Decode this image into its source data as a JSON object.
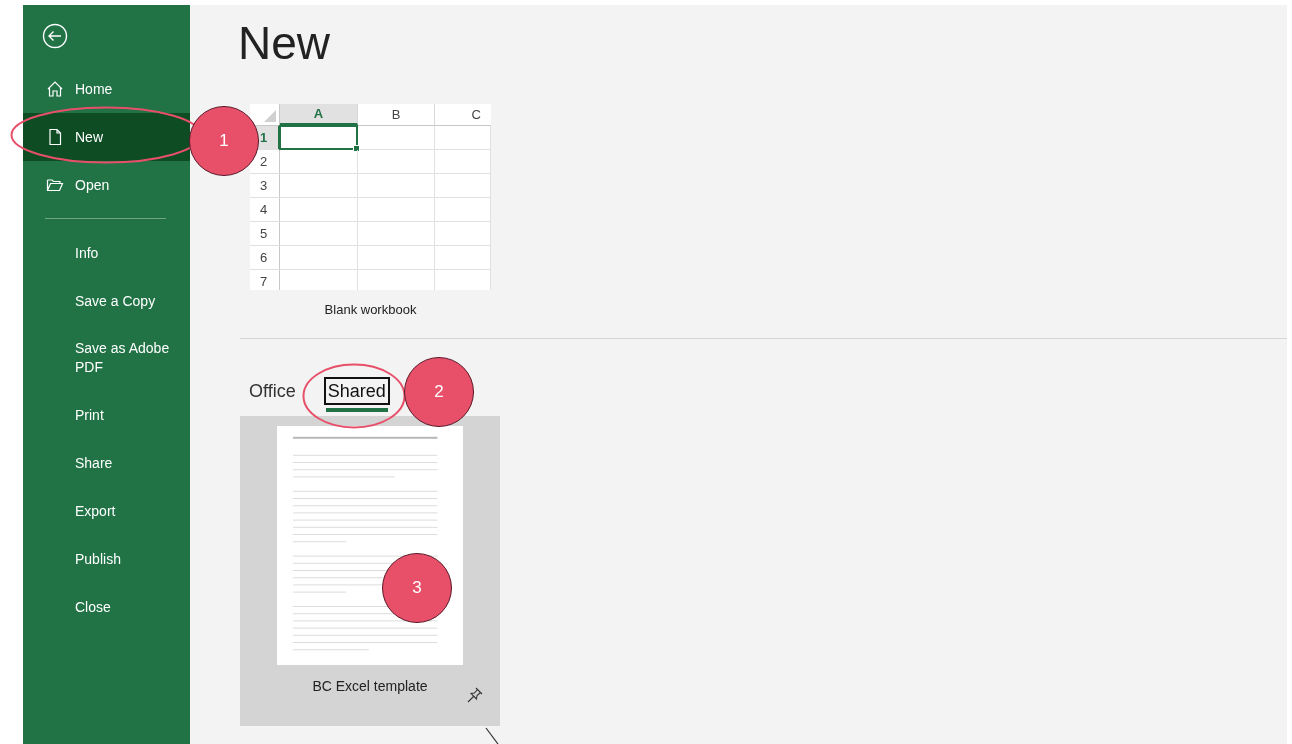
{
  "sidebar": {
    "primary_items": [
      {
        "label": "Home",
        "selected": false
      },
      {
        "label": "New",
        "selected": true
      },
      {
        "label": "Open",
        "selected": false
      }
    ],
    "secondary_items": [
      {
        "label": "Info",
        "selected": false
      },
      {
        "label": "Save a Copy",
        "selected": false
      },
      {
        "label": "Save as Adobe PDF",
        "selected": false
      },
      {
        "label": "Print",
        "selected": false
      },
      {
        "label": "Share",
        "selected": false
      },
      {
        "label": "Export",
        "selected": false
      },
      {
        "label": "Publish",
        "selected": false
      },
      {
        "label": "Close",
        "selected": false
      }
    ]
  },
  "page_title": "New",
  "blank_workbook": {
    "columns": [
      {
        "label": "A",
        "selected": true
      },
      {
        "label": "B",
        "selected": false
      },
      {
        "label": "C",
        "selected": false
      }
    ],
    "rows": [
      {
        "label": "1",
        "selected": true
      },
      {
        "label": "2",
        "selected": false
      },
      {
        "label": "3",
        "selected": false
      },
      {
        "label": "4",
        "selected": false
      },
      {
        "label": "5",
        "selected": false
      },
      {
        "label": "6",
        "selected": false
      },
      {
        "label": "7",
        "selected": false
      }
    ],
    "label": "Blank workbook"
  },
  "tabs": [
    {
      "label": "Office",
      "selected": false
    },
    {
      "label": "Shared",
      "selected": true
    }
  ],
  "templates": [
    {
      "label": "BC Excel template"
    }
  ],
  "callouts": [
    {
      "label": "1"
    },
    {
      "label": "2"
    },
    {
      "label": "3"
    }
  ]
}
